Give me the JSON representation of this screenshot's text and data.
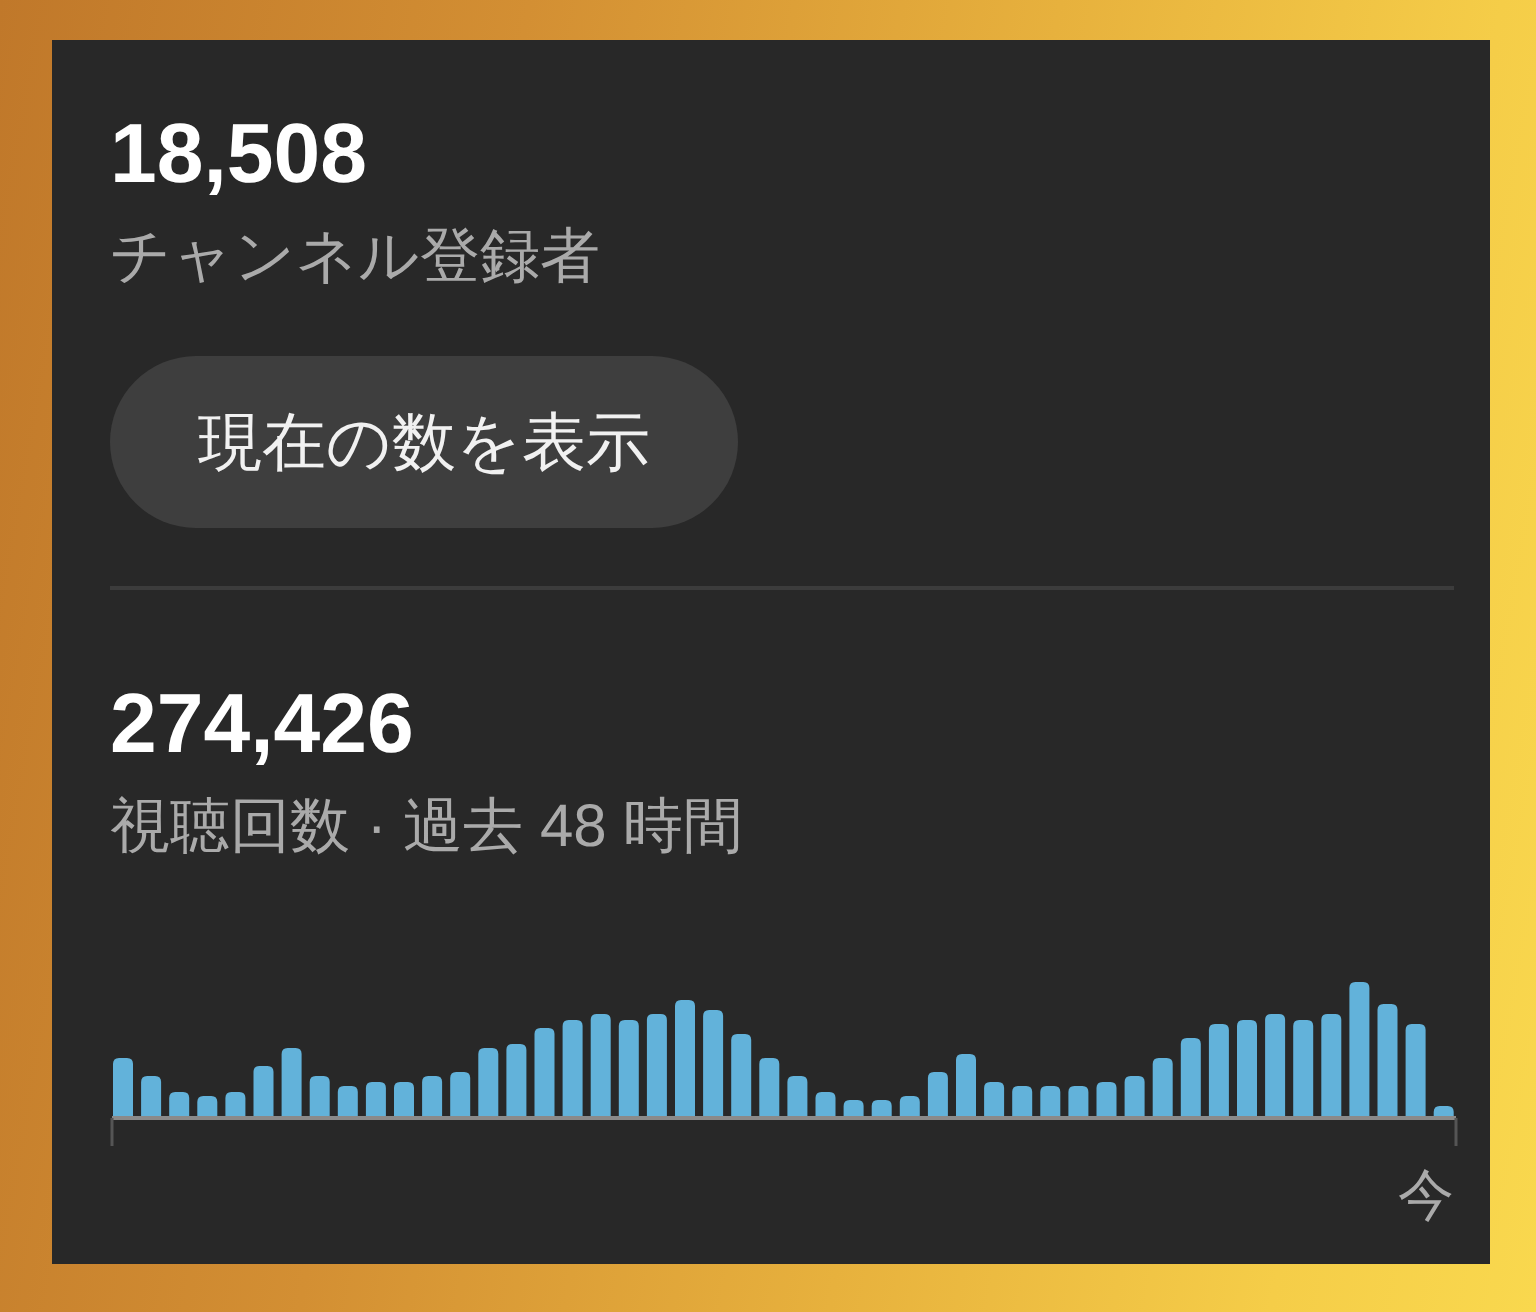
{
  "subscribers": {
    "count": "18,508",
    "label": "チャンネル登録者",
    "button": "現在の数を表示"
  },
  "views": {
    "count": "274,426",
    "label": "視聴回数 · 過去 48 時間",
    "chart": {
      "end_label": "今"
    }
  }
}
